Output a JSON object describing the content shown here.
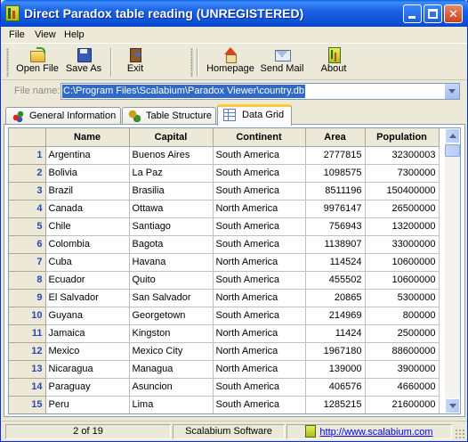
{
  "window": {
    "title": "Direct Paradox table reading (UNREGISTERED)",
    "controls": [
      "minimize",
      "maximize",
      "close"
    ]
  },
  "menu": {
    "items": [
      "File",
      "View",
      "Help"
    ]
  },
  "toolbar": {
    "open_label": "Open File",
    "save_label": "Save As",
    "exit_label": "Exit",
    "home_label": "Homepage",
    "mail_label": "Send Mail",
    "about_label": "About",
    "icons": [
      "folder-open-icon",
      "floppy-disk-icon",
      "exit-door-icon",
      "home-icon",
      "envelope-icon",
      "about-logo-icon"
    ]
  },
  "file": {
    "label": "File name:",
    "value": "C:\\Program Files\\Scalabium\\Paradox Viewer\\country.db"
  },
  "tabs": [
    {
      "label": "General Information",
      "icon": "info-shapes-icon",
      "active": false
    },
    {
      "label": "Table Structure",
      "icon": "structure-icon",
      "active": false
    },
    {
      "label": "Data Grid",
      "icon": "grid-icon",
      "active": true
    }
  ],
  "grid": {
    "columns": [
      "Name",
      "Capital",
      "Continent",
      "Area",
      "Population"
    ],
    "rows": [
      {
        "n": "1",
        "name": "Argentina",
        "capital": "Buenos Aires",
        "continent": "South America",
        "area": "2777815",
        "population": "32300003"
      },
      {
        "n": "2",
        "name": "Bolivia",
        "capital": "La Paz",
        "continent": "South America",
        "area": "1098575",
        "population": "7300000"
      },
      {
        "n": "3",
        "name": "Brazil",
        "capital": "Brasilia",
        "continent": "South America",
        "area": "8511196",
        "population": "150400000"
      },
      {
        "n": "4",
        "name": "Canada",
        "capital": "Ottawa",
        "continent": "North America",
        "area": "9976147",
        "population": "26500000"
      },
      {
        "n": "5",
        "name": "Chile",
        "capital": "Santiago",
        "continent": "South America",
        "area": "756943",
        "population": "13200000"
      },
      {
        "n": "6",
        "name": "Colombia",
        "capital": "Bagota",
        "continent": "South America",
        "area": "1138907",
        "population": "33000000"
      },
      {
        "n": "7",
        "name": "Cuba",
        "capital": "Havana",
        "continent": "North America",
        "area": "114524",
        "population": "10600000"
      },
      {
        "n": "8",
        "name": "Ecuador",
        "capital": "Quito",
        "continent": "South America",
        "area": "455502",
        "population": "10600000"
      },
      {
        "n": "9",
        "name": "El Salvador",
        "capital": "San Salvador",
        "continent": "North America",
        "area": "20865",
        "population": "5300000"
      },
      {
        "n": "10",
        "name": "Guyana",
        "capital": "Georgetown",
        "continent": "South America",
        "area": "214969",
        "population": "800000"
      },
      {
        "n": "11",
        "name": "Jamaica",
        "capital": "Kingston",
        "continent": "North America",
        "area": "11424",
        "population": "2500000"
      },
      {
        "n": "12",
        "name": "Mexico",
        "capital": "Mexico City",
        "continent": "North America",
        "area": "1967180",
        "population": "88600000"
      },
      {
        "n": "13",
        "name": "Nicaragua",
        "capital": "Managua",
        "continent": "North America",
        "area": "139000",
        "population": "3900000"
      },
      {
        "n": "14",
        "name": "Paraguay",
        "capital": "Asuncion",
        "continent": "South America",
        "area": "406576",
        "population": "4660000"
      },
      {
        "n": "15",
        "name": "Peru",
        "capital": "Lima",
        "continent": "South America",
        "area": "1285215",
        "population": "21600000"
      }
    ]
  },
  "status": {
    "record": "2 of 19",
    "company": "Scalabium Software",
    "url": "http://www.scalabium.com"
  },
  "colors": {
    "titlebar": "#0b4fd4",
    "row_number": "#2a46b0",
    "selection": "#316ac5",
    "active_tab_accent": "#ffc83c"
  }
}
